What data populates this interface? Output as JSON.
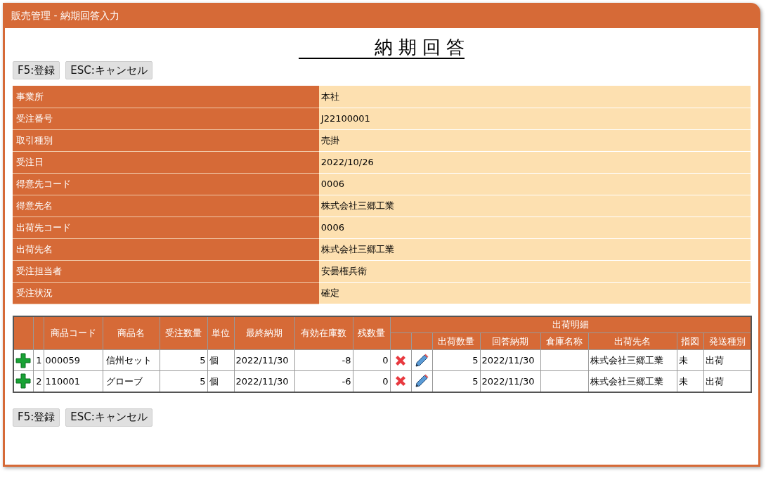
{
  "window": {
    "title": "販売管理 - 納期回答入力"
  },
  "heading": "納 期 回 答",
  "buttons_top": [
    "F5:登録",
    "ESC:キャンセル"
  ],
  "info": [
    {
      "label": "事業所",
      "value": "本社"
    },
    {
      "label": "受注番号",
      "value": "J22100001"
    },
    {
      "label": "取引種別",
      "value": "売掛"
    },
    {
      "label": "受注日",
      "value": "2022/10/26"
    },
    {
      "label": "得意先コード",
      "value": "0006"
    },
    {
      "label": "得意先名",
      "value": "株式会社三郷工業"
    },
    {
      "label": "出荷先コード",
      "value": "0006"
    },
    {
      "label": "出荷先名",
      "value": "株式会社三郷工業"
    },
    {
      "label": "受注担当者",
      "value": "安曇権兵衛"
    },
    {
      "label": "受注状況",
      "value": "確定"
    }
  ],
  "table": {
    "columns": [
      "商品コード",
      "商品名",
      "受注数量",
      "単位",
      "最終納期",
      "有効在庫数",
      "残数量"
    ],
    "group_header": "出荷明細",
    "sub_columns": [
      "出荷数量",
      "回答納期",
      "倉庫名称",
      "出荷先名",
      "指図",
      "発送種別"
    ],
    "rows": [
      {
        "no": "1",
        "code": "000059",
        "name": "信州セット",
        "qty": "5",
        "unit": "個",
        "due": "2022/11/30",
        "stock": "-8",
        "remaining": "0",
        "ship_qty": "5",
        "answer_date": "2022/11/30",
        "ship_to": "株式会社三郷工業",
        "instruction": "未",
        "ship_type": "出荷"
      },
      {
        "no": "2",
        "code": "110001",
        "name": "グローブ",
        "qty": "5",
        "unit": "個",
        "due": "2022/11/30",
        "stock": "-6",
        "remaining": "0",
        "ship_qty": "5",
        "answer_date": "2022/11/30",
        "ship_to": "株式会社三郷工業",
        "instruction": "未",
        "ship_type": "出荷"
      }
    ]
  },
  "buttons_bottom": [
    "F5:登録",
    "ESC:キャンセル"
  ]
}
